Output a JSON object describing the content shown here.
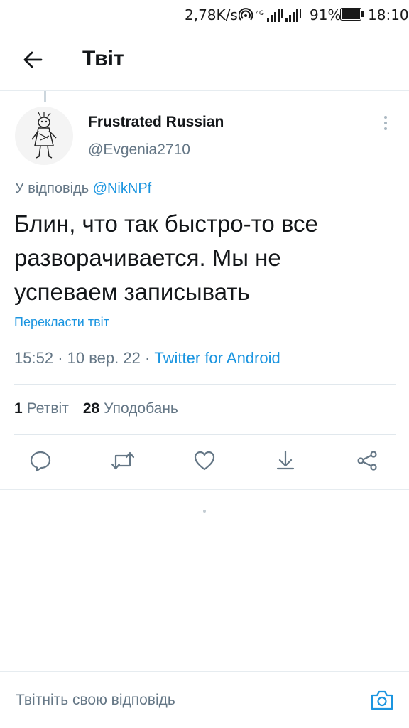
{
  "status_bar": {
    "speed": "2,78K/s",
    "network": "4G",
    "battery": "91%",
    "time": "18:10"
  },
  "header": {
    "title": "Твіт",
    "back_icon": "arrow-left-icon"
  },
  "tweet": {
    "author_name": "Frustrated Russian",
    "author_handle": "@Evgenia2710",
    "reply_prefix": "У відповідь",
    "reply_to": "@NikNPf",
    "text": "Блин, что так быстро-то все разворачивается. Мы не успеваем записывать",
    "translate_label": "Перекласти твіт",
    "time": "15:52",
    "separator": "·",
    "date": "10 вер. 22",
    "source": "Twitter for Android",
    "retweets_count": "1",
    "retweets_label": "Ретвіт",
    "likes_count": "28",
    "likes_label": "Уподобань"
  },
  "actions": {
    "icons": [
      "reply-icon",
      "retweet-icon",
      "like-icon",
      "bookmark-icon",
      "share-icon"
    ]
  },
  "reply_bar": {
    "placeholder": "Твітніть свою відповідь",
    "camera_icon": "camera-icon"
  },
  "colors": {
    "accent": "#1b95e0",
    "secondary_text": "#657786",
    "primary_text": "#14171a",
    "divider": "#e1e8ed"
  }
}
